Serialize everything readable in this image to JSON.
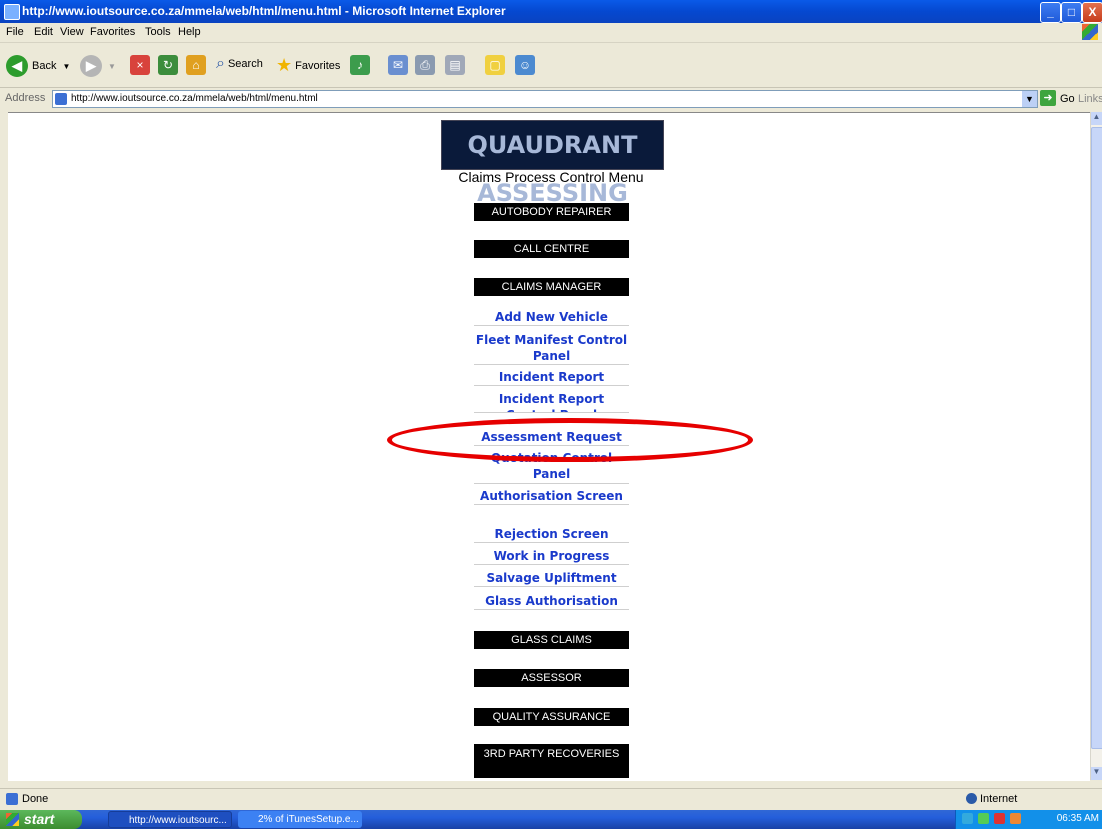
{
  "window": {
    "title": "http://www.ioutsource.co.za/mmela/web/html/menu.html - Microsoft Internet Explorer",
    "minimize": "_",
    "maximize": "□",
    "close": "X"
  },
  "menubar": [
    "File",
    "Edit",
    "View",
    "Favorites",
    "Tools",
    "Help"
  ],
  "toolbar": {
    "back": "Back",
    "search": "Search",
    "favorites": "Favorites"
  },
  "address": {
    "label": "Address",
    "url": "http://www.ioutsource.co.za/mmela/web/html/menu.html",
    "go": "Go",
    "links": "Links"
  },
  "page": {
    "logo_text": "QUAUDRANT ASSESSING",
    "subtitle": "Claims Process Control Menu",
    "sections": {
      "autobody": "AUTOBODY REPAIRER",
      "call_centre": "CALL CENTRE",
      "claims_manager": "CLAIMS MANAGER",
      "glass_claims": "GLASS CLAIMS",
      "assessor": "ASSESSOR",
      "quality": "QUALITY ASSURANCE",
      "third_party": "3RD PARTY RECOVERIES"
    },
    "links": {
      "add_vehicle": "Add New Vehicle",
      "fleet": "Fleet Manifest Control Panel",
      "incident": "Incident Report",
      "incident_panel": "Incident Report Control Panel",
      "assessment": "Assessment Request",
      "quotation_panel": "Quotation Control Panel",
      "authorisation": "Authorisation Screen",
      "rejection": "Rejection Screen",
      "wip": "Work in Progress",
      "salvage": "Salvage Upliftment",
      "glass_auth": "Glass Authorisation"
    }
  },
  "status": {
    "text": "Done",
    "zone": "Internet"
  },
  "taskbar": {
    "start": "start",
    "task1": "http://www.ioutsourc...",
    "task2": "2% of iTunesSetup.e...",
    "clock": "06:35 AM"
  }
}
